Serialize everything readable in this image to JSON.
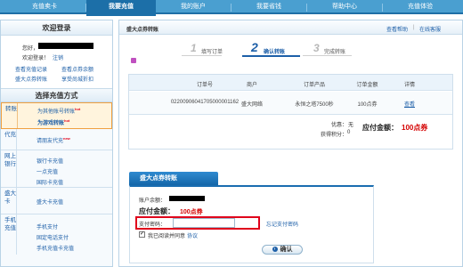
{
  "nav": {
    "items": [
      "充值卖卡",
      "我要充值",
      "我的账户",
      "我要省钱",
      "帮助中心",
      "充值体验"
    ],
    "active_index": 1
  },
  "sidebar": {
    "login_title": "欢迎登录",
    "hello": "您好，",
    "welcome": "欢迎登录！",
    "logout": "注销",
    "links": [
      "查看充值记录",
      "查看点券余额",
      "盛大点券转账",
      "享受尚城折扣"
    ],
    "pay_method_title": "选择充值方式",
    "categories": [
      {
        "label": "转账",
        "items": [
          "为其他账号转账",
          "为游戏转账"
        ],
        "hot": [
          true,
          true
        ],
        "selected": true
      },
      {
        "label": "代充",
        "items": [
          "请朋友代充"
        ],
        "hot": [
          true
        ]
      },
      {
        "label": "网上银行",
        "items": [
          "银行卡充值",
          "一点充值",
          "国际卡充值"
        ]
      },
      {
        "label": "盛大卡",
        "items": [
          "盛大卡充值"
        ]
      },
      {
        "label": "手机充值",
        "items": [
          "手机支付",
          "固定电话支付",
          "手机充值卡充值"
        ]
      }
    ],
    "hot_label": "hot"
  },
  "main": {
    "breadcrumb": "盛大点券转账",
    "help_link": "查看帮助",
    "service_link": "在线客服",
    "steps": [
      {
        "num": "1",
        "label": "填写订单"
      },
      {
        "num": "2",
        "label": "确认转账"
      },
      {
        "num": "3",
        "label": "完成转账"
      }
    ],
    "current_step": 2,
    "order": {
      "headers": [
        "订单号",
        "商户",
        "订单产品",
        "订单金额",
        "详情"
      ],
      "row": [
        "02200906041705000001162",
        "盛大网络",
        "永恒之塔7500秒",
        "100点券",
        "查看"
      ],
      "discount_label": "优惠：",
      "discount_value": "无",
      "points_label": "获得积分：",
      "points_value": "0",
      "total_label": "应付金额：",
      "total_value": "100点券"
    },
    "pay": {
      "header": "盛大点券转账",
      "balance_label": "账户余额：",
      "amount_label": "应付金额：",
      "amount_value": "100点券",
      "password_label": "支付密码：",
      "forgot_link": "忘记支付密码",
      "agree_text": "我已阅读并同意",
      "agreement_link": "协议",
      "confirm_label": "确认"
    }
  }
}
